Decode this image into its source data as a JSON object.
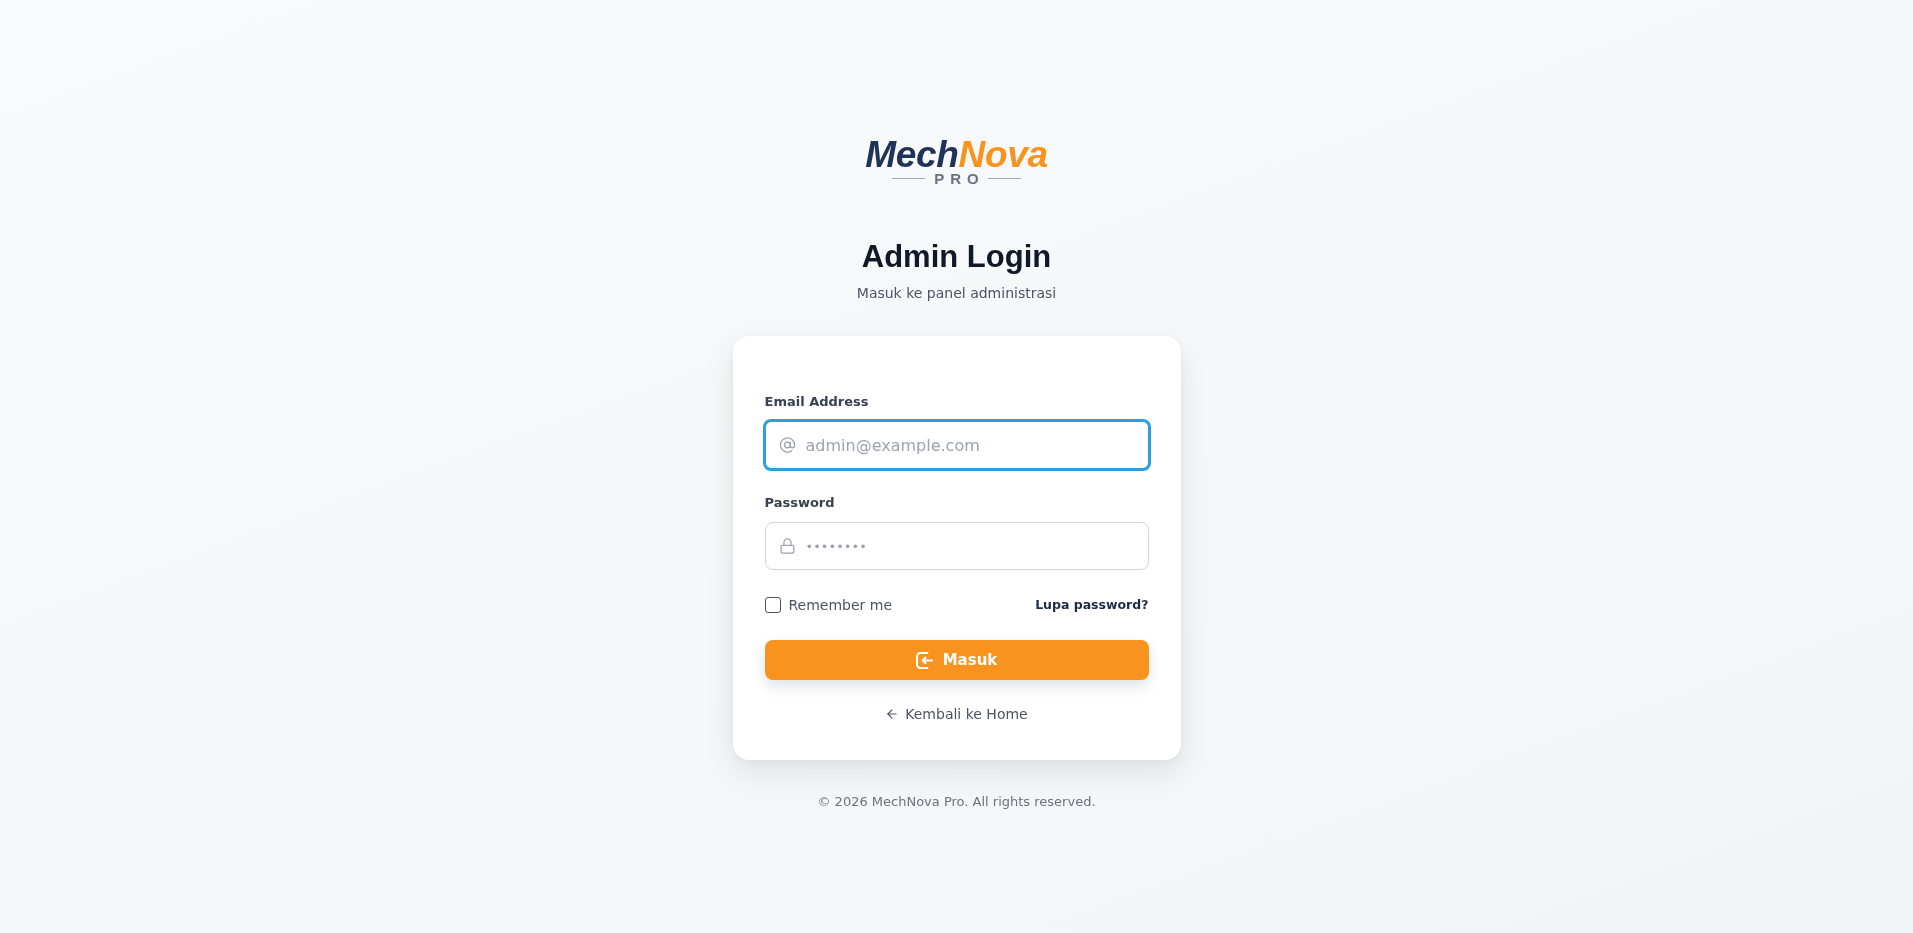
{
  "logo": {
    "wordmark_primary": "Mech",
    "wordmark_accent": "Nova",
    "tagline": "PRO"
  },
  "header": {
    "title": "Admin Login",
    "subtitle": "Masuk ke panel administrasi"
  },
  "form": {
    "fields": [
      {
        "kind": "email",
        "label": "Email Address",
        "placeholder": "admin@example.com",
        "focused": true
      },
      {
        "kind": "password",
        "label": "Password",
        "placeholder": "••••••••",
        "focused": false
      }
    ],
    "remember": {
      "label": "Remember me",
      "checked": false
    },
    "forgot_link": "Lupa password?",
    "submit_button": "Masuk",
    "back_link": "Kembali ke Home"
  },
  "footer": {
    "copyright": "© 2026 MechNova Pro. All rights reserved."
  }
}
